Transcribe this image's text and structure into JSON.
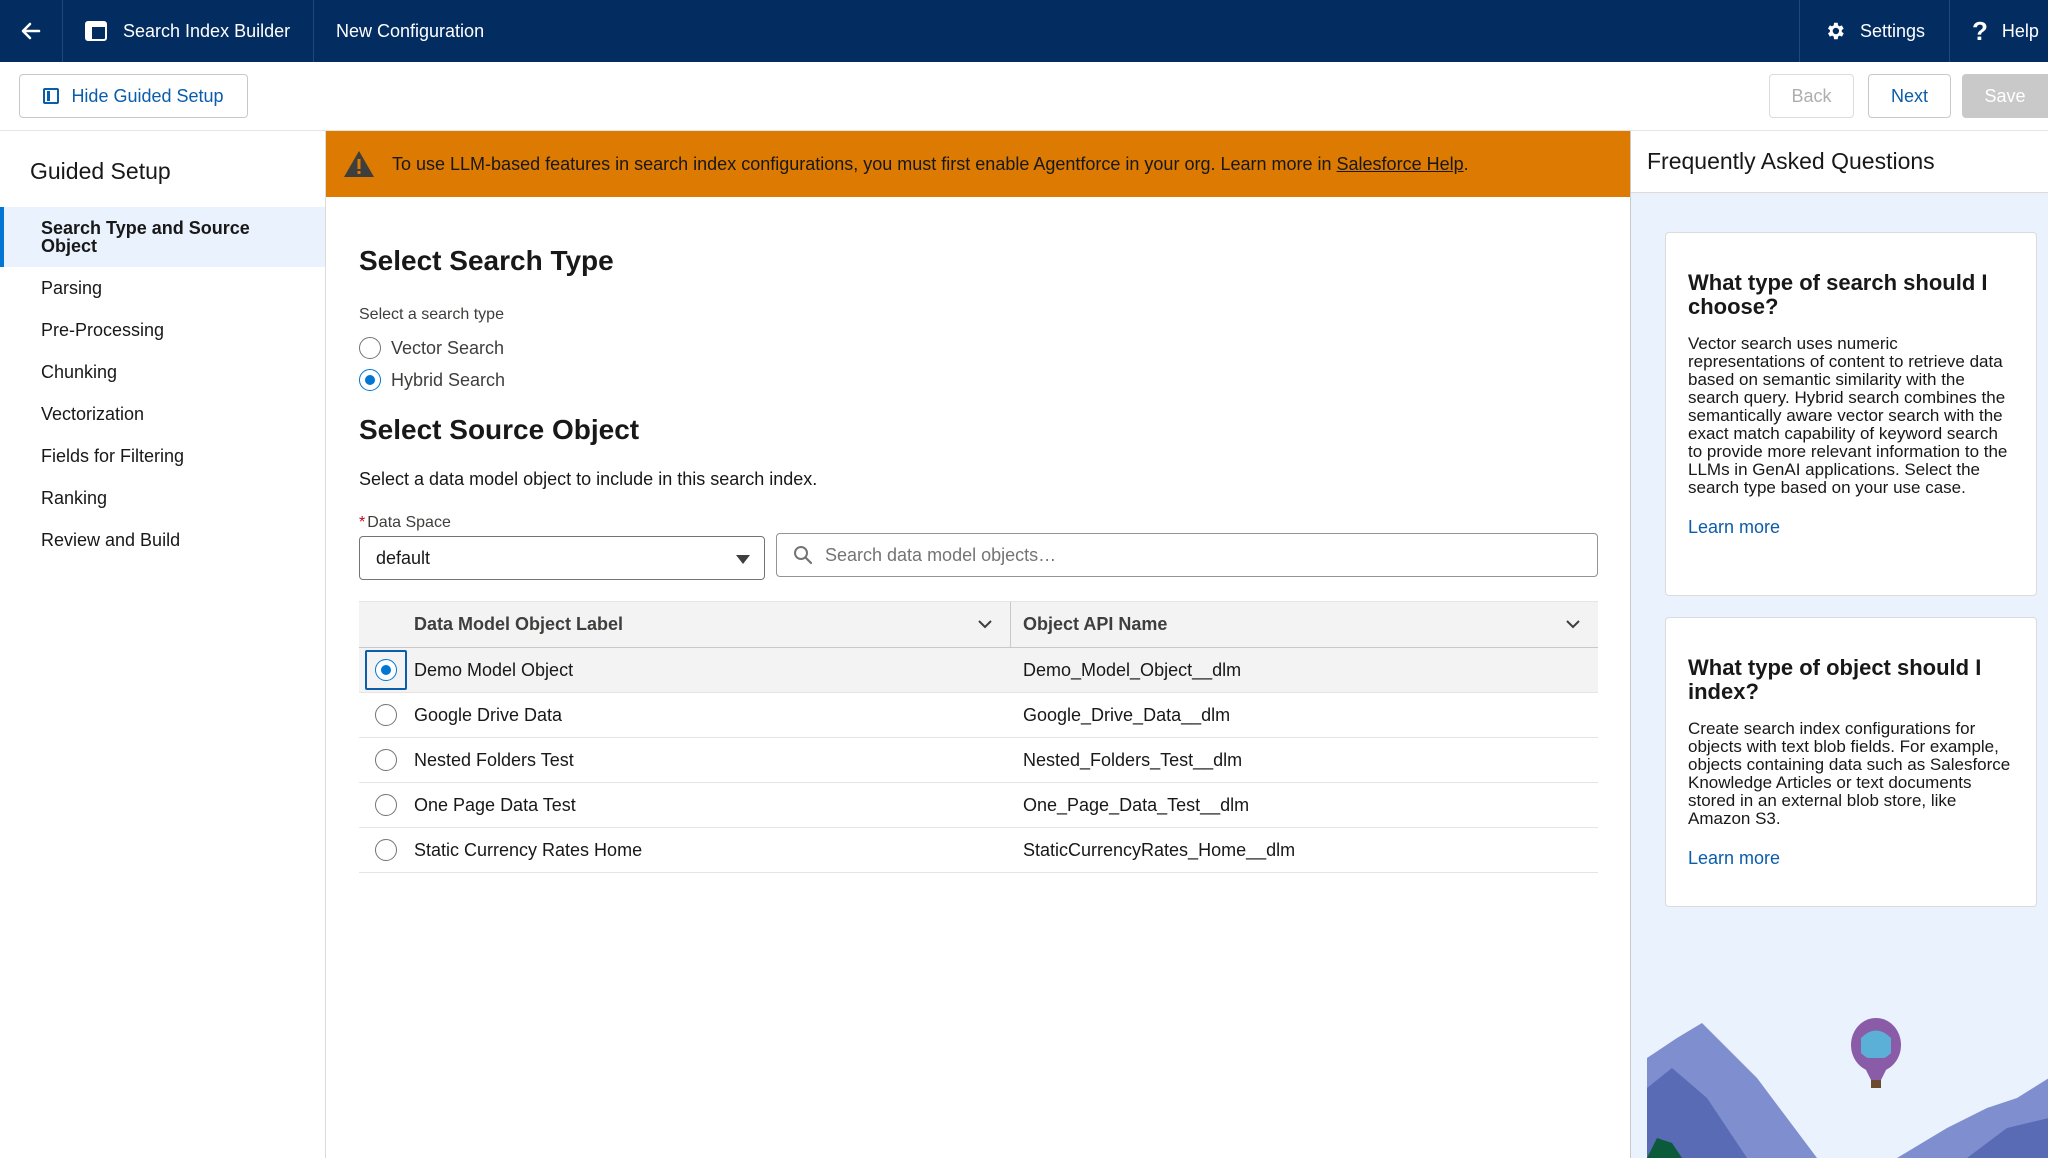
{
  "topbar": {
    "app_name": "Search Index Builder",
    "config_name": "New Configuration",
    "settings_label": "Settings",
    "help_label": "Help"
  },
  "toolbar": {
    "hide_setup_label": "Hide Guided Setup",
    "back_label": "Back",
    "next_label": "Next",
    "save_label": "Save"
  },
  "sidebar": {
    "title": "Guided Setup",
    "steps": [
      {
        "label": "Search Type and Source Object",
        "active": true
      },
      {
        "label": "Parsing"
      },
      {
        "label": "Pre-Processing"
      },
      {
        "label": "Chunking"
      },
      {
        "label": "Vectorization"
      },
      {
        "label": "Fields for Filtering"
      },
      {
        "label": "Ranking"
      },
      {
        "label": "Review and Build"
      }
    ]
  },
  "banner": {
    "text": "To use LLM-based features in search index configurations, you must first enable Agentforce in your org. Learn more in ",
    "link": "Salesforce Help",
    "suffix": "."
  },
  "search_type": {
    "title": "Select Search Type",
    "label": "Select a search type",
    "options": [
      "Vector Search",
      "Hybrid Search"
    ],
    "selected": "Hybrid Search"
  },
  "source_object": {
    "title": "Select Source Object",
    "description": "Select a data model object to include in this search index.",
    "data_space_label": "Data Space",
    "data_space_value": "default",
    "search_placeholder": "Search data model objects…",
    "columns": [
      "Data Model Object Label",
      "Object API Name"
    ],
    "rows": [
      {
        "label": "Demo Model Object",
        "api": "Demo_Model_Object__dlm",
        "selected": true
      },
      {
        "label": "Google Drive Data",
        "api": "Google_Drive_Data__dlm"
      },
      {
        "label": "Nested Folders Test",
        "api": "Nested_Folders_Test__dlm"
      },
      {
        "label": "One Page Data Test",
        "api": "One_Page_Data_Test__dlm"
      },
      {
        "label": "Static Currency Rates Home",
        "api": "StaticCurrencyRates_Home__dlm"
      }
    ]
  },
  "faq": {
    "title": "Frequently Asked Questions",
    "cards": [
      {
        "question": "What type of search should I choose?",
        "answer": "Vector search uses numeric representations of content to retrieve data based on semantic similarity with the search query. Hybrid search combines the semantically aware vector search with the exact match capability of keyword search to provide more relevant information to the LLMs in GenAI applications. Select the search type based on your use case.",
        "link": "Learn more"
      },
      {
        "question": "What type of object should I index?",
        "answer": "Create search index configurations for objects with text blob fields. For example, objects containing data such as Salesforce Knowledge Articles or text documents stored in an external blob store, like Amazon S3.",
        "link": "Learn more"
      }
    ]
  },
  "colors": {
    "nav": "#032d60",
    "brand": "#0176d3",
    "warning": "#dd7a01",
    "faq_bg": "#e9f2fd"
  },
  "icons": [
    "back-arrow-icon",
    "app-table-icon",
    "gear-icon",
    "question-icon",
    "panel-icon",
    "warning-icon",
    "search-icon",
    "chevron-down-icon",
    "balloon-icon"
  ]
}
